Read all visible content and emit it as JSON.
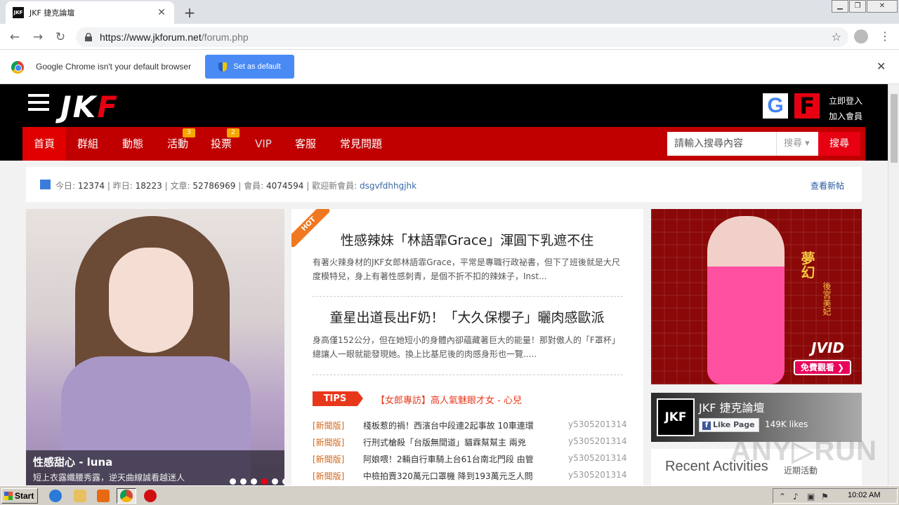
{
  "browser": {
    "tab_title": "JKF 捷克論壇",
    "tab_favicon": "JKF",
    "url_host": "https://www.jkforum.net",
    "url_path": "/forum.php",
    "default_bar_text": "Google Chrome isn't your default browser",
    "set_default_label": "Set as default"
  },
  "site": {
    "logo_main": "JK",
    "logo_accent": "F",
    "login": "立即登入",
    "register": "加入會員",
    "google_label": "G",
    "facebook_label": "F",
    "nav": [
      {
        "label": "首頁"
      },
      {
        "label": "群組"
      },
      {
        "label": "動態"
      },
      {
        "label": "活動",
        "badge": "3"
      },
      {
        "label": "投票",
        "badge": "2"
      },
      {
        "label": "VIP"
      },
      {
        "label": "客服"
      },
      {
        "label": "常見問題"
      }
    ],
    "search_placeholder": "請輸入搜尋內容",
    "search_select": "搜尋 ▾",
    "search_button": "搜尋"
  },
  "stats": {
    "today_label": "今日:",
    "today": "12374",
    "yesterday_label": "昨日:",
    "yesterday": "18223",
    "posts_label": "文章:",
    "posts": "52786969",
    "members_label": "會員:",
    "members": "4074594",
    "welcome_label": "歡迎新會員:",
    "new_member": "dsgvfdhhgjhk",
    "new_posts_link": "查看新帖"
  },
  "hero": {
    "title": "性感甜心 - luna",
    "subtitle": "短上衣露纖腰秀露，逆天曲線誠看越迷人"
  },
  "center": {
    "hot_label": "HOT",
    "articles": [
      {
        "title": "性感辣妹「林語霏Grace」渾圓下乳遮不住",
        "summary": "有著火辣身材的JKF女郎林語霏Grace，平常是專職行政祕書，但下了班後就是大尺度模特兒，身上有著性感刺青，是個不折不扣的辣妹子，Inst..."
      },
      {
        "title": "童星出道長出F奶！「大久保櫻子」曬肉感歐派",
        "summary": "身高僅152公分，但在她短小的身體內卻蘊藏著巨大的能量！那對傲人的「F罩杯」總讓人一眼就能發現她。換上比基尼後的肉感身形也一覽....."
      }
    ],
    "tips_label": "TIPS",
    "tips_text": "【女郎專訪】高人氣魅眼才女 - 心兒",
    "news": [
      {
        "tag": "[新聞版]",
        "title": "棧板惹的禍！西濱台中段連2起事故 10車連環",
        "author": "y5305201314"
      },
      {
        "tag": "[新聞版]",
        "title": "行刑式槍殺「台版無間道」貓霖幫幫主 兩兇",
        "author": "y5305201314"
      },
      {
        "tag": "[新聞版]",
        "title": "阿娘喂！2輛自行車騎上台61台南北門段 由管",
        "author": "y5305201314"
      },
      {
        "tag": "[新聞版]",
        "title": "中檢拍賣320萬元口罩機 降到193萬元乏人問",
        "author": "y5305201314"
      }
    ]
  },
  "ad": {
    "title_cn": "夢幻",
    "subtitle_cn": "後宮美妃",
    "brand": "JVID",
    "button": "免費觀看 ❯"
  },
  "fb": {
    "logo": "JKF",
    "name": "JKF 捷克論壇",
    "like_label": "Like Page",
    "likes": "149K likes"
  },
  "recent": {
    "title": "Recent Activities",
    "subtitle": "近期活動"
  },
  "watermark": "ANY▷RUN",
  "taskbar": {
    "start": "Start",
    "clock": "10:02 AM"
  }
}
